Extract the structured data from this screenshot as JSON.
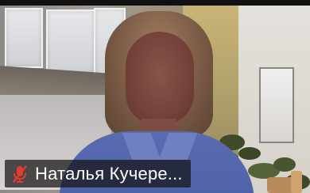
{
  "participant": {
    "name": "Наталья Кучере...",
    "mic_status_icon": "muted-microphone-icon",
    "muted_color": "#e53935"
  }
}
